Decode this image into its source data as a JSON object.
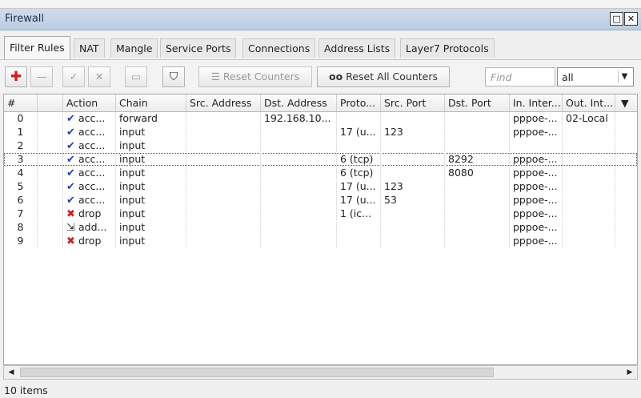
{
  "window": {
    "title": "Firewall",
    "restore_glyph": "□",
    "close_glyph": "✕"
  },
  "tabs": [
    {
      "label": "Filter Rules",
      "active": true
    },
    {
      "label": "NAT"
    },
    {
      "label": "Mangle"
    },
    {
      "label": "Service Ports"
    },
    {
      "label": "Connections"
    },
    {
      "label": "Address Lists"
    },
    {
      "label": "Layer7 Protocols"
    }
  ],
  "toolbar": {
    "add_glyph": "✚",
    "remove_glyph": "—",
    "enable_glyph": "✓",
    "disable_glyph": "✕",
    "comment_glyph": "▭",
    "filter_glyph": "⛉",
    "reset_counters_glyph": "☰",
    "reset_counters_label": "Reset Counters",
    "reset_all_glyph": "oo",
    "reset_all_label": "Reset All Counters",
    "find_placeholder": "Find",
    "filter_select_value": "all",
    "select_arrow_glyph": "▼"
  },
  "table": {
    "columns": [
      "#",
      "",
      "Action",
      "Chain",
      "Src. Address",
      "Dst. Address",
      "Proto...",
      "Src. Port",
      "Dst. Port",
      "In. Inter...",
      "Out. Int...",
      ""
    ],
    "header_sort_glyph": "▼",
    "rows": [
      {
        "num": "0",
        "action_icon": "accept",
        "action": "acc...",
        "chain": "forward",
        "src": "",
        "dst": "192.168.10...",
        "proto": "",
        "sport": "",
        "dport": "",
        "in": "pppoe-...",
        "out": "02-Local"
      },
      {
        "num": "1",
        "action_icon": "accept",
        "action": "acc...",
        "chain": "input",
        "src": "",
        "dst": "",
        "proto": "17 (u...",
        "sport": "123",
        "dport": "",
        "in": "pppoe-...",
        "out": ""
      },
      {
        "num": "2",
        "action_icon": "accept",
        "action": "acc...",
        "chain": "input",
        "src": "",
        "dst": "",
        "proto": "",
        "sport": "",
        "dport": "",
        "in": "",
        "out": ""
      },
      {
        "num": "3",
        "action_icon": "accept",
        "action": "acc...",
        "chain": "input",
        "src": "",
        "dst": "",
        "proto": "6 (tcp)",
        "sport": "",
        "dport": "8292",
        "in": "pppoe-...",
        "out": "",
        "selected": true
      },
      {
        "num": "4",
        "action_icon": "accept",
        "action": "acc...",
        "chain": "input",
        "src": "",
        "dst": "",
        "proto": "6 (tcp)",
        "sport": "",
        "dport": "8080",
        "in": "pppoe-...",
        "out": ""
      },
      {
        "num": "5",
        "action_icon": "accept",
        "action": "acc...",
        "chain": "input",
        "src": "",
        "dst": "",
        "proto": "17 (u...",
        "sport": "123",
        "dport": "",
        "in": "pppoe-...",
        "out": ""
      },
      {
        "num": "6",
        "action_icon": "accept",
        "action": "acc...",
        "chain": "input",
        "src": "",
        "dst": "",
        "proto": "17 (u...",
        "sport": "53",
        "dport": "",
        "in": "pppoe-...",
        "out": ""
      },
      {
        "num": "7",
        "action_icon": "drop",
        "action": "drop",
        "chain": "input",
        "src": "",
        "dst": "",
        "proto": "1 (ic...",
        "sport": "",
        "dport": "",
        "in": "pppoe-...",
        "out": ""
      },
      {
        "num": "8",
        "action_icon": "add",
        "action": "add...",
        "chain": "input",
        "src": "",
        "dst": "",
        "proto": "",
        "sport": "",
        "dport": "",
        "in": "pppoe-...",
        "out": ""
      },
      {
        "num": "9",
        "action_icon": "drop",
        "action": "drop",
        "chain": "input",
        "src": "",
        "dst": "",
        "proto": "",
        "sport": "",
        "dport": "",
        "in": "pppoe-...",
        "out": ""
      }
    ]
  },
  "icons": {
    "accept": "✔",
    "drop": "✖",
    "add": "⇲"
  },
  "scrollbar": {
    "left_glyph": "◀",
    "right_glyph": "▶"
  },
  "status": {
    "items_count": "10 items"
  }
}
